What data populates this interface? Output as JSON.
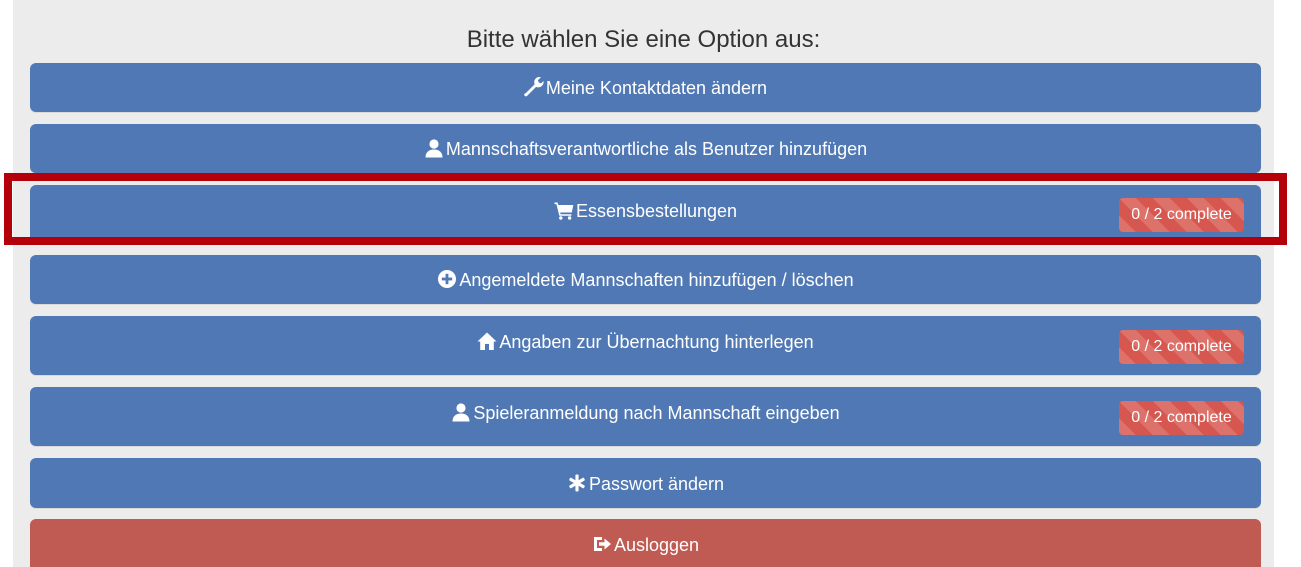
{
  "heading": "Bitte wählen Sie eine Option aus:",
  "menu": [
    {
      "label": "Meine Kontaktdaten ändern",
      "icon": "wrench-icon"
    },
    {
      "label": "Mannschaftsverantwortliche als Benutzer hinzufügen",
      "icon": "user-icon"
    },
    {
      "label": "Essensbestellungen",
      "icon": "shopping-cart-icon",
      "badge": "0 / 2 complete"
    },
    {
      "label": "Angemeldete Mannschaften hinzufügen / löschen",
      "icon": "plus-circle-icon"
    },
    {
      "label": "Angaben zur Übernachtung hinterlegen",
      "icon": "home-icon",
      "badge": "0 / 2 complete"
    },
    {
      "label": "Spieleranmeldung nach Mannschaft eingeben",
      "icon": "user-icon",
      "badge": "0 / 2 complete"
    },
    {
      "label": "Passwort ändern",
      "icon": "asterisk-icon"
    },
    {
      "label": "Ausloggen",
      "icon": "log-out-icon"
    }
  ],
  "colors": {
    "primary_button": "#5078b4",
    "logout_button": "#c05b53",
    "badge": "#d6574f",
    "highlight_frame": "#b3000a",
    "panel_background": "#ececec"
  }
}
